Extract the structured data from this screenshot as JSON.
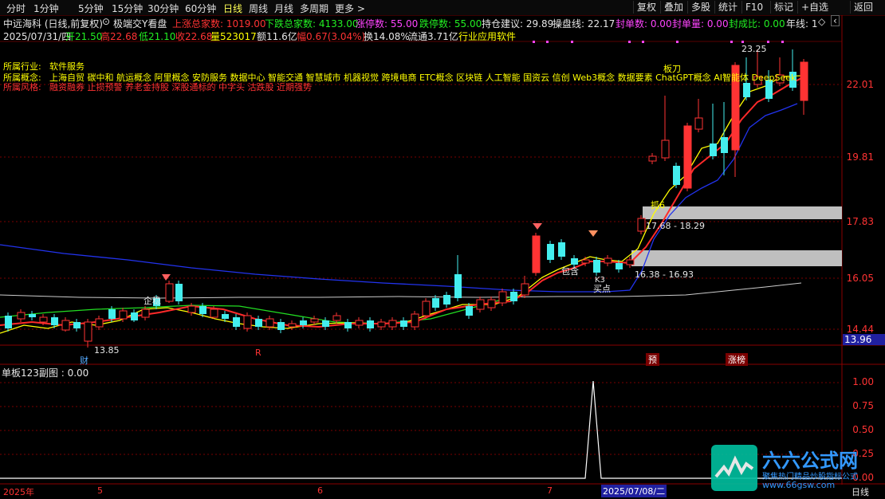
{
  "toolbar": {
    "periods": [
      "分时",
      "1分钟",
      "5分钟",
      "15分钟",
      "30分钟",
      "60分钟",
      "日线",
      "周线",
      "月线",
      "多周期",
      "更多 >"
    ],
    "active_period": "日线",
    "right_buttons": [
      "复权",
      "叠加",
      "多股",
      "统计",
      "F10",
      "标记",
      "+自选",
      "返回"
    ]
  },
  "info_bar": {
    "title": "中远海科 (日线,前复权)",
    "indicator_name": "极端交Y看盘",
    "up_count_label": "上涨总家数: 1019.00",
    "down_count_label": "下跌总家数: 4133.00",
    "limit_up_label": "涨停数: 55.00",
    "limit_down_label": "跌停数: 55.00",
    "hold_advice": "持仓建议: 29.89",
    "control_line": "操盘线: 22.17",
    "seal_count": "封单数: 0.00",
    "seal_amount": "封单量: 0.00",
    "seal_ratio": "封成比: 0.00",
    "year_line": "年线: 1"
  },
  "quote_bar": {
    "date": "2025/07/31/四",
    "open": "开21.50",
    "high": "高22.68",
    "low": "低21.10",
    "close": "收22.68",
    "volume": "量523017",
    "amount": "额11.6亿",
    "change": "幅0.67(3.04%)",
    "turnover": "换14.08%",
    "float": "流通3.71亿",
    "industry_tail": "行业应用软件"
  },
  "sectors": {
    "industry_label": "所属行业:",
    "industry_value": "软件服务",
    "concept_label": "所属概念:",
    "concept_value": "上海自贸 碳中和 航运概念 阿里概念 安防服务 数据中心 智能交通 智慧城市 机器视觉 跨境电商 ETC概念 区块链 人工智能 国资云 信创 Web3概念 数据要素 ChatGPT概念 AI智能体 DeepSeek",
    "style_label": "所属风格:",
    "style_value": "融资融券 止损预警 养老金持股 深股通标的 中字头 沽跌股 近期强势"
  },
  "price_axis": [
    "22.01",
    "19.81",
    "17.83",
    "16.05",
    "14.44"
  ],
  "last_price_tag": "13.96",
  "annotations": {
    "high_mark": "23.25",
    "low_mark": "13.85",
    "zone_upper": "17.68 - 18.29",
    "zone_lower": "16.38 - 16.93",
    "label_qiwen": "企稳",
    "label_baohan": "包含",
    "label_buy": "买点",
    "label_k3": "K3",
    "label_zhua6": "抓6",
    "label_banda": "板刀",
    "label_cai": "财",
    "label_r": "R",
    "label_yu": "预",
    "label_zhangbang": "涨榜"
  },
  "indicator": {
    "title": "单板123副图 : 0.00",
    "axis": [
      "1.00",
      "0.75",
      "0.50",
      "0.25",
      "0.00"
    ]
  },
  "time_axis": {
    "labels": [
      "2025年",
      "5",
      "6",
      "7"
    ],
    "cursor_date": "2025/07/08/二",
    "right_tab": "日线"
  },
  "watermark": {
    "brand": "六六公式网",
    "tagline": "聚焦热门精品炒股指标公式",
    "url": "www.66gsw.com"
  },
  "colors": {
    "up": "#ff3333",
    "down": "#44eeee",
    "ma_yellow": "#ffff00",
    "ma_green": "#22dd22",
    "ma_blue": "#2233ee",
    "ma_white": "#cccccc"
  }
}
